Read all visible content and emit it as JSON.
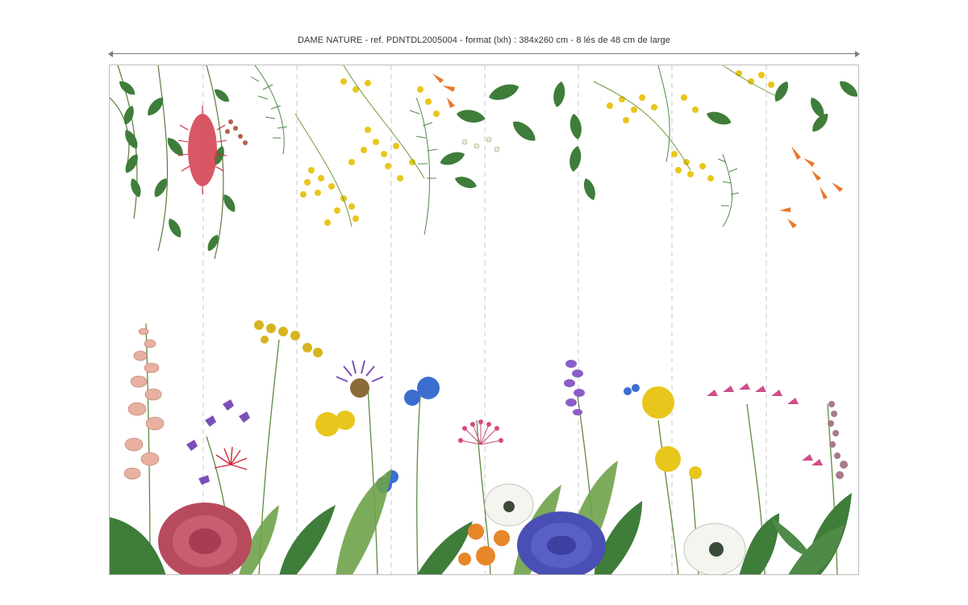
{
  "caption": "DAME NATURE  - ref. PDNTDL2005004 - format (lxh) : 384x260 cm - 8 lés de 48 cm de large",
  "panels": {
    "count": 8
  },
  "colors": {
    "leaf_green": "#3f7d3a",
    "light_green": "#7fae5a",
    "mimosa_yellow": "#e8c61c",
    "bottlebrush_red": "#c8283c",
    "orange_flower": "#e8782a",
    "purple_flower": "#6a4bb0",
    "blue_dahlia": "#4a4fb5",
    "pink_protea": "#b84a5e",
    "foxglove_pink": "#e8b0a0"
  }
}
